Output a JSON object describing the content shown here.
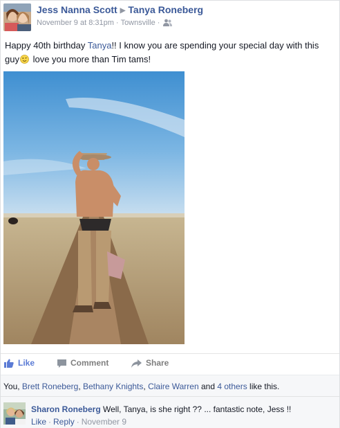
{
  "post": {
    "author": "Jess Nanna Scott",
    "recipient": "Tanya Roneberg",
    "timestamp": "November 9 at 8:31pm",
    "location": "Townsville",
    "text_before": "Happy 40th birthday ",
    "text_tag": "Tanya",
    "text_after_tag": "!! I know you are spending your special day with this guy",
    "text_end": " love you more than Tim tams!"
  },
  "actions": {
    "like": "Like",
    "comment": "Comment",
    "share": "Share"
  },
  "likes": {
    "prefix": "You, ",
    "name1": "Brett Roneberg",
    "sep1": ", ",
    "name2": "Bethany Knights",
    "sep2": ", ",
    "name3": "Claire Warren",
    "sep3": " and ",
    "others": "4 others",
    "suffix": " like this."
  },
  "comment": {
    "author": "Sharon Roneberg",
    "text": " Well, Tanya, is she right ?? ... fantastic note, Jess !!",
    "like": "Like",
    "reply": "Reply",
    "date": "November 9"
  },
  "colors": {
    "link": "#3b5998",
    "like_action": "#5b7bd5",
    "muted": "#9197a3"
  }
}
